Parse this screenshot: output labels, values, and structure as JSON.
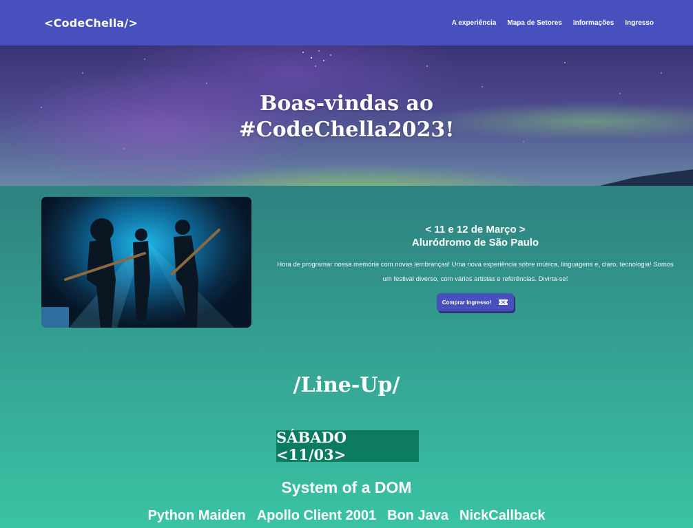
{
  "nav": {
    "logo": "<CodeChella/>",
    "links": [
      "A experiência",
      "Mapa de Setores",
      "Informações",
      "Ingresso"
    ]
  },
  "hero": {
    "title_line1": "Boas-vindas ao",
    "title_line2": "#CodeChella2023!"
  },
  "event": {
    "dates": "< 11 e 12 de Março >",
    "venue": "Aluródromo de São Paulo",
    "description": "Hora de programar nossa memória com novas lembranças! Uma nova experiência sobre música, linguagens e, claro, tecnologia! Somos um festival diverso, com vários artistas e referências. Divirta-se!",
    "buy_button": "Comprar Ingresso!",
    "buy_icon": "ticket-icon"
  },
  "lineup": {
    "title": "/Line-Up/",
    "day": "SÁBADO <11/03>",
    "headliner": "System of a DOM",
    "artists": [
      "Python Maiden",
      "Apollo Client 2001",
      "Bon Java",
      "NickCallback"
    ]
  },
  "colors": {
    "navbar": "#4750bd",
    "day_badge": "#0d7b5f",
    "background_top": "#2e7378",
    "background_bottom": "#3ac3a3"
  }
}
